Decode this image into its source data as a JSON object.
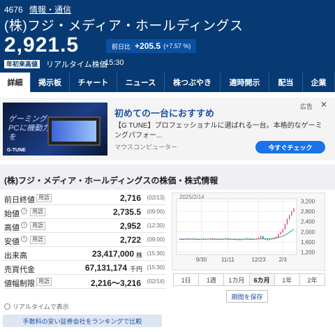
{
  "stock": {
    "code": "4676",
    "industry": "情報・通信",
    "name": "(株)フジ・メディア・ホールディングス",
    "price": "2,921.5",
    "change_label": "前日比",
    "change": "+205.5",
    "change_pct": "(+7.57 %)",
    "badge": "年初来高値",
    "realtime_label": "リアルタイム株価",
    "time": "15:30"
  },
  "tabs": [
    "詳細",
    "掲示板",
    "チャート",
    "ニュース",
    "株つぶやき",
    "適時開示",
    "配当",
    "企業"
  ],
  "ad": {
    "slogan": "ゲーミングPCに機動力を",
    "brand": "G-TUNE",
    "title": "初めての一台におすすめ",
    "description": "【G TUNE】プロフェッショナルに選ばれる一台。本格的なゲーミングパフォー...",
    "sponsor": "マウスコンピューター",
    "cta": "今すぐチェック",
    "ad_label": "広告",
    "close": "✕"
  },
  "section": {
    "title": "(株)フジ・メディア・ホールディングスの株価・株式情報",
    "tag_label": "用語",
    "rows": [
      {
        "name": "前日終値",
        "value": "2,716",
        "unit": "",
        "time": "(02/13)",
        "clock": false
      },
      {
        "name": "始値",
        "value": "2,735.5",
        "unit": "",
        "time": "(09:00)",
        "clock": true
      },
      {
        "name": "高値",
        "value": "2,952",
        "unit": "",
        "time": "(12:30)",
        "clock": true
      },
      {
        "name": "安値",
        "value": "2,722",
        "unit": "",
        "time": "(09:00)",
        "clock": true
      },
      {
        "name": "出来高",
        "value": "23,417,000",
        "unit": "株",
        "time": "(15:30)",
        "clock": false
      },
      {
        "name": "売買代金",
        "value": "67,131,174",
        "unit": "千円",
        "time": "(15:30)",
        "clock": false
      },
      {
        "name": "値幅制限",
        "value": "2,216～3,216",
        "unit": "",
        "time": "(02/14)",
        "clock": false
      }
    ],
    "realtime_note": "リアルタイムで表示",
    "rank_button": "手数料の安い証券会社をランキングで比較",
    "save_button": "期間を保存",
    "ranges": [
      "1日",
      "1週",
      "1カ月",
      "6カ月",
      "1年",
      "2年"
    ],
    "active_range": "6カ月"
  },
  "chart_data": {
    "type": "line",
    "date_label": "2025/2/14",
    "x_ticks": [
      "9/30",
      "11/11",
      "12/23",
      "2/3"
    ],
    "y_ticks": [
      1200,
      1600,
      2000,
      2400,
      2800,
      3200
    ],
    "ylim": [
      1100,
      3300
    ],
    "y_tick_labels": [
      "3,200",
      "2,800",
      "2,400",
      "2,000",
      "1,600",
      "1,200"
    ],
    "series": [
      {
        "type": "candle",
        "values": [
          1720,
          1710,
          1700,
          1730,
          1715,
          1705,
          1720,
          1700,
          1690,
          1710,
          1720,
          1705,
          1700,
          1715,
          1730,
          1710,
          1695,
          1705,
          1690,
          1700,
          1715,
          1735,
          1720,
          1700,
          1710,
          1690,
          1700,
          1680,
          1695,
          1710,
          1730,
          1720,
          1700,
          1690,
          1705,
          1720,
          1760,
          1820,
          1720,
          1700,
          1680,
          1700,
          1720,
          1760,
          1800,
          1900,
          1980,
          2100,
          2300,
          2500,
          2650,
          2800,
          2920
        ]
      },
      {
        "type": "moving-average",
        "values": [
          1700,
          1700,
          1702,
          1705,
          1708,
          1709,
          1710,
          1710,
          1708,
          1706,
          1705,
          1705,
          1706,
          1707,
          1708,
          1709,
          1710,
          1710,
          1709,
          1708,
          1707,
          1707,
          1706,
          1706,
          1706,
          1705,
          1705,
          1705,
          1704,
          1704,
          1705,
          1706,
          1707,
          1708,
          1710,
          1712,
          1716,
          1722,
          1726,
          1728,
          1728,
          1729,
          1732,
          1740,
          1752,
          1770,
          1795,
          1828,
          1870,
          1920,
          1980,
          2040,
          2100
        ]
      }
    ]
  }
}
